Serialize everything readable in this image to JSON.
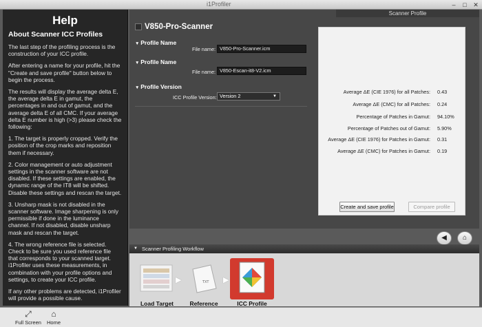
{
  "window": {
    "title": "i1Profiler"
  },
  "help": {
    "title": "Help",
    "subtitle": "About Scanner ICC Profiles",
    "paragraphs": [
      "The last step of the profiling process is the construction of your ICC profile.",
      "After entering a name for your profile, hit the \"Create and save profile\" button below to begin the process.",
      "The results will display the average delta E, the average delta E in gamut, the percentages in and out of gamut, and the average delta E of all CMC. If your average delta E number is high (>3) please check the following:",
      "1. The target is properly cropped. Verify the position of the crop marks and reposition them if necessary.",
      "2. Color management or auto adjustment settings in the scanner software are not disabled. If these settings are enabled, the dynamic range of the IT8 will be shifted. Disable these settings and rescan the target.",
      "3. Unsharp mask is not disabled in the scanner software. Image sharpening is only permissible if done in the luminance channel. If not disabled, disable unsharp mask and rescan the target.",
      "4. The wrong reference file is selected. Check to be sure you used reference file that corresponds to your scanned target. i1Profiler uses these measurements, in combination with your profile options and settings, to create your ICC profile.",
      "If any other problems are detected, i1Profiler will provide a possible cause."
    ]
  },
  "main": {
    "panel_header": "Scanner Profile",
    "scanner_name": "V850-Pro-Scanner",
    "sections": [
      {
        "title": "Profile Name",
        "field_label": "File name:",
        "field_value": "V850-Pro-Scanner.icm"
      },
      {
        "title": "Profile Name",
        "field_label": "File name:",
        "field_value": "V850-Escan-it8-V2.icm"
      }
    ],
    "icc_section": {
      "title": "Profile Version",
      "label": "ICC Profile Version:",
      "value": "Version 2"
    }
  },
  "results": {
    "rows": [
      {
        "label": "Average ΔE (CIE 1976) for all Patches:",
        "value": "0.43"
      },
      {
        "label": "Average ΔE (CMC) for all Patches:",
        "value": "0.24"
      },
      {
        "label": "Percentage of Patches in Gamut:",
        "value": "94.10%"
      },
      {
        "label": "Percentage of Patches out of Gamut:",
        "value": "5.90%"
      },
      {
        "label": "Average ΔE (CIE 1976) for Patches in Gamut:",
        "value": "0.31"
      },
      {
        "label": "Average ΔE (CMC) for Patches in Gamut:",
        "value": "0.19"
      }
    ],
    "create_button": "Create and save profile",
    "compare_button": "Compare profile"
  },
  "workflow": {
    "header": "Scanner Profiling Workflow",
    "steps": [
      {
        "label": "Load Target"
      },
      {
        "label": "Reference"
      },
      {
        "label": "ICC Profile"
      }
    ]
  },
  "bottombar": {
    "fullscreen": "Full Screen",
    "home": "Home"
  },
  "colors": {
    "accent": "#d23a2e",
    "help_bg": "#262626",
    "results_bg": "#f2f2f2"
  }
}
